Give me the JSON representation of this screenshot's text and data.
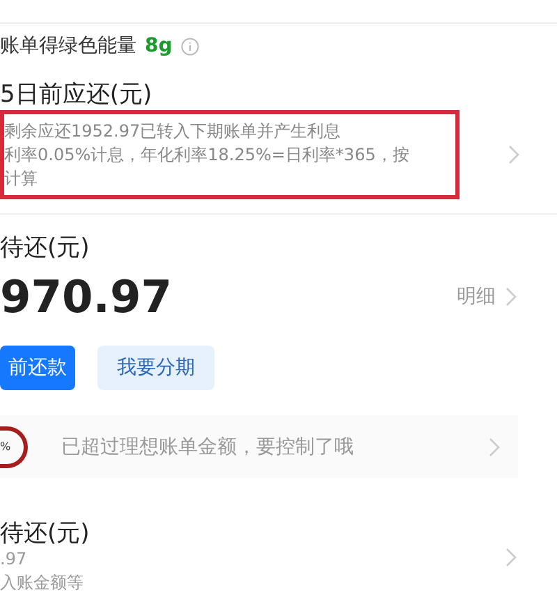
{
  "green_energy": {
    "label": "账单得绿色能量",
    "amount": "8g"
  },
  "due_card": {
    "title": "5日前应还(元)",
    "note_lines": [
      "剩余应还1952.97已转入下期账单并产生利息",
      "利率0.05%计息，年化利率18.25%=日利率*365，按",
      "计算"
    ]
  },
  "pending": {
    "title": "待还(元)",
    "amount": "970.97",
    "detail_link": "明细"
  },
  "buttons": [
    {
      "label": "前还款",
      "kind": "primary"
    },
    {
      "label": "我要分期",
      "kind": "secondary"
    }
  ],
  "tip": {
    "ring_label": "%",
    "text": "已超过理想账单金额，要控制了哦"
  },
  "next_bill": {
    "title": "待还(元)",
    "amount": ".97",
    "note": "入账金额等"
  }
}
